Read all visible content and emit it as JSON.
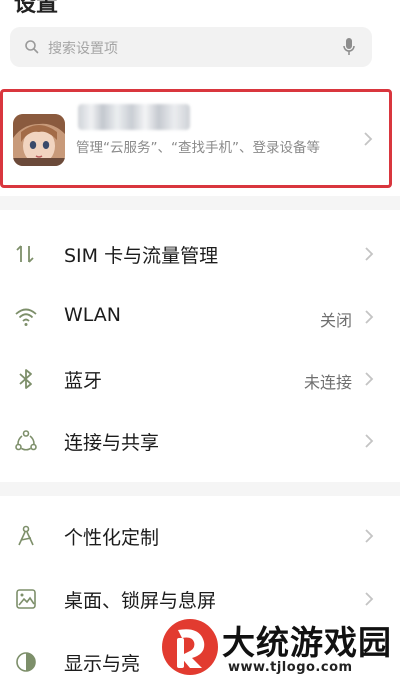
{
  "header": {
    "title": "设置"
  },
  "search": {
    "placeholder": "搜索设置项",
    "icon": "search-icon",
    "mic_icon": "microphone-icon"
  },
  "account": {
    "avatar_icon": "user-avatar",
    "description": "管理“云服务”、“查找手机”、登录设备等",
    "highlight_color": "#d9363e"
  },
  "settings": {
    "group1": [
      {
        "label": "SIM 卡与流量管理",
        "value": "",
        "icon": "sim-data-icon"
      },
      {
        "label": "WLAN",
        "value": "关闭",
        "icon": "wifi-icon"
      },
      {
        "label": "蓝牙",
        "value": "未连接",
        "icon": "bluetooth-icon"
      },
      {
        "label": "连接与共享",
        "value": "",
        "icon": "share-icon"
      }
    ],
    "group2": [
      {
        "label": "个性化定制",
        "value": "",
        "icon": "personalize-icon"
      },
      {
        "label": "桌面、锁屏与息屏",
        "value": "",
        "icon": "wallpaper-icon"
      },
      {
        "label": "显示与亮",
        "value": "",
        "icon": "brightness-icon"
      }
    ]
  },
  "watermark": {
    "title": "大统游戏园",
    "url": "www.tjlogo.com"
  },
  "colors": {
    "icon_green": "#7d8f6a",
    "chevron": "#c4c4c4",
    "divider": "#f5f5f5"
  }
}
